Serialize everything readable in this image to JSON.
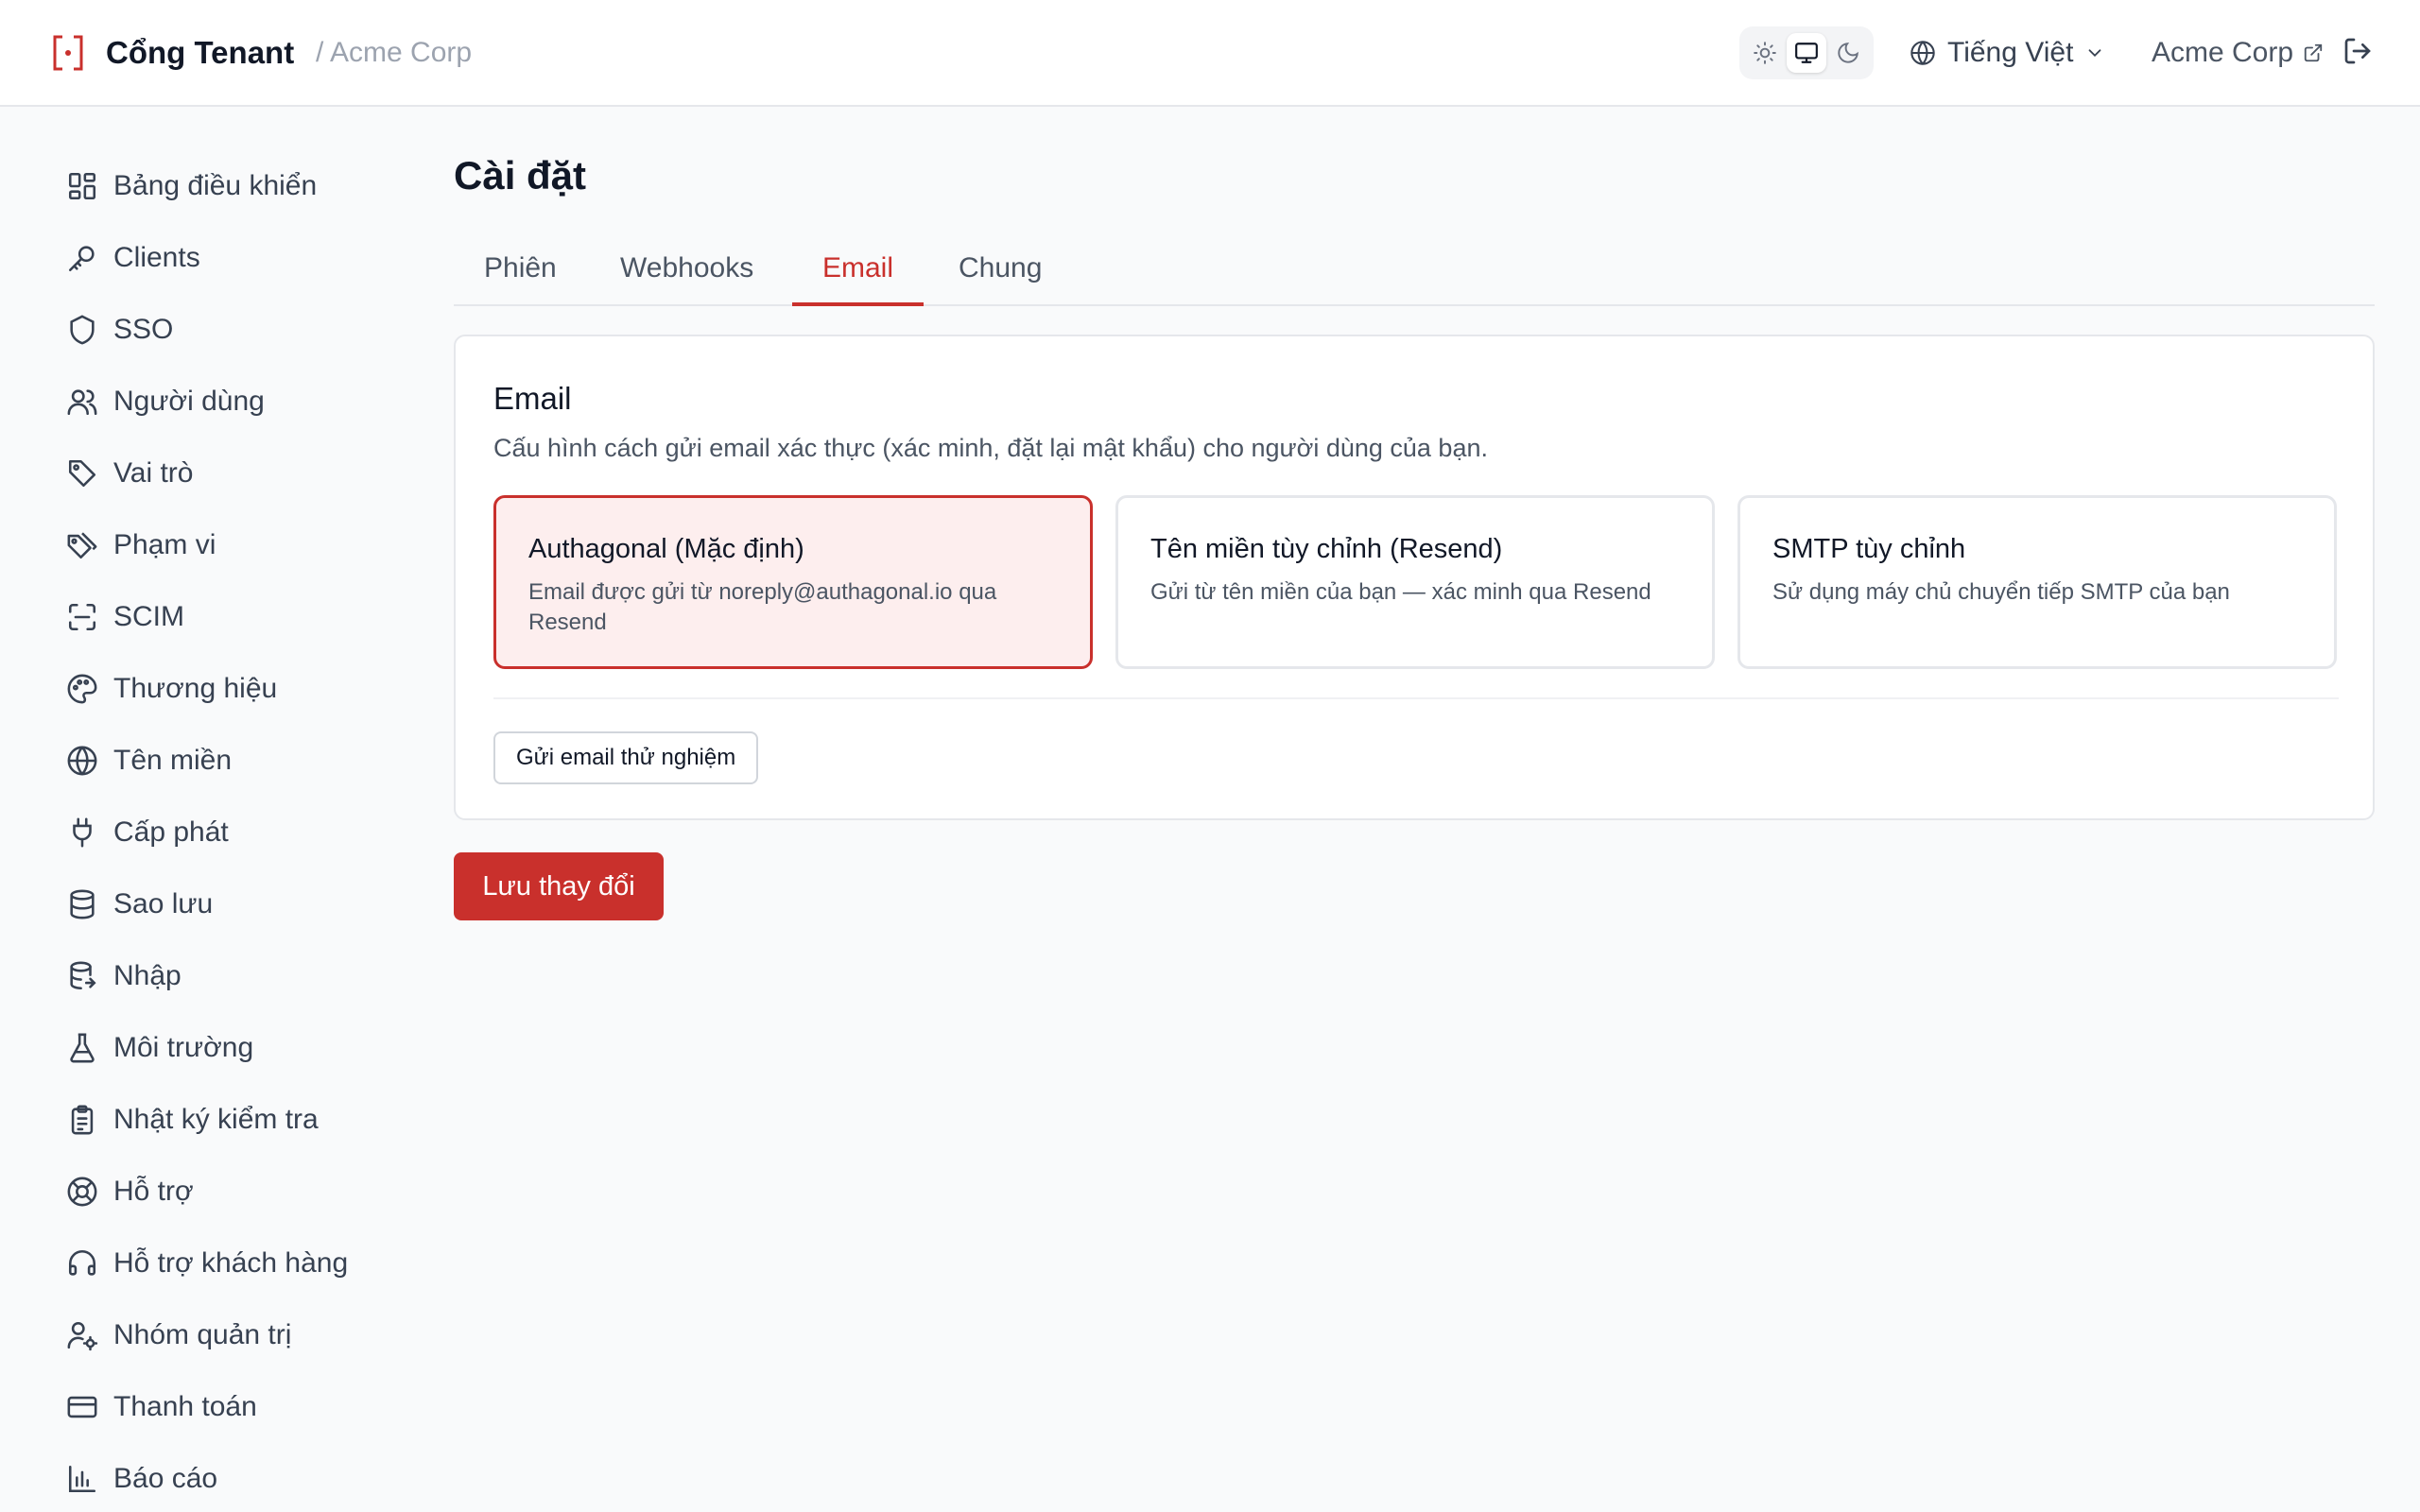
{
  "header": {
    "app_title": "Cổng Tenant",
    "breadcrumb": "/ Acme Corp",
    "language": "Tiếng Việt",
    "tenant_name": "Acme Corp"
  },
  "sidebar": {
    "items": [
      {
        "label": "Bảng điều khiển",
        "icon": "dashboard-icon"
      },
      {
        "label": "Clients",
        "icon": "key-icon"
      },
      {
        "label": "SSO",
        "icon": "shield-icon"
      },
      {
        "label": "Người dùng",
        "icon": "users-icon"
      },
      {
        "label": "Vai trò",
        "icon": "tag-icon"
      },
      {
        "label": "Phạm vi",
        "icon": "tags-icon"
      },
      {
        "label": "SCIM",
        "icon": "scan-icon"
      },
      {
        "label": "Thương hiệu",
        "icon": "palette-icon"
      },
      {
        "label": "Tên miền",
        "icon": "globe-icon"
      },
      {
        "label": "Cấp phát",
        "icon": "plug-icon"
      },
      {
        "label": "Sao lưu",
        "icon": "database-icon"
      },
      {
        "label": "Nhập",
        "icon": "database-import-icon"
      },
      {
        "label": "Môi trường",
        "icon": "flask-icon"
      },
      {
        "label": "Nhật ký kiểm tra",
        "icon": "clipboard-icon"
      },
      {
        "label": "Hỗ trợ",
        "icon": "lifebuoy-icon"
      },
      {
        "label": "Hỗ trợ khách hàng",
        "icon": "headset-icon"
      },
      {
        "label": "Nhóm quản trị",
        "icon": "user-cog-icon"
      },
      {
        "label": "Thanh toán",
        "icon": "credit-card-icon"
      },
      {
        "label": "Báo cáo",
        "icon": "bar-chart-icon"
      }
    ]
  },
  "main": {
    "title": "Cài đặt",
    "tabs": [
      {
        "label": "Phiên",
        "active": false
      },
      {
        "label": "Webhooks",
        "active": false
      },
      {
        "label": "Email",
        "active": true
      },
      {
        "label": "Chung",
        "active": false
      }
    ],
    "email_card": {
      "title": "Email",
      "description": "Cấu hình cách gửi email xác thực (xác minh, đặt lại mật khẩu) cho người dùng của bạn.",
      "options": [
        {
          "title": "Authagonal (Mặc định)",
          "description": "Email được gửi từ noreply@authagonal.io qua Resend",
          "selected": true
        },
        {
          "title": "Tên miền tùy chỉnh (Resend)",
          "description": "Gửi từ tên miền của bạn — xác minh qua Resend",
          "selected": false
        },
        {
          "title": "SMTP tùy chỉnh",
          "description": "Sử dụng máy chủ chuyển tiếp SMTP của bạn",
          "selected": false
        }
      ],
      "test_button": "Gửi email thử nghiệm"
    },
    "save_button": "Lưu thay đổi"
  },
  "colors": {
    "accent": "#c9302c",
    "selected_bg": "#fdeeee",
    "border": "#e5e7eb",
    "text_muted": "#4b5563"
  }
}
